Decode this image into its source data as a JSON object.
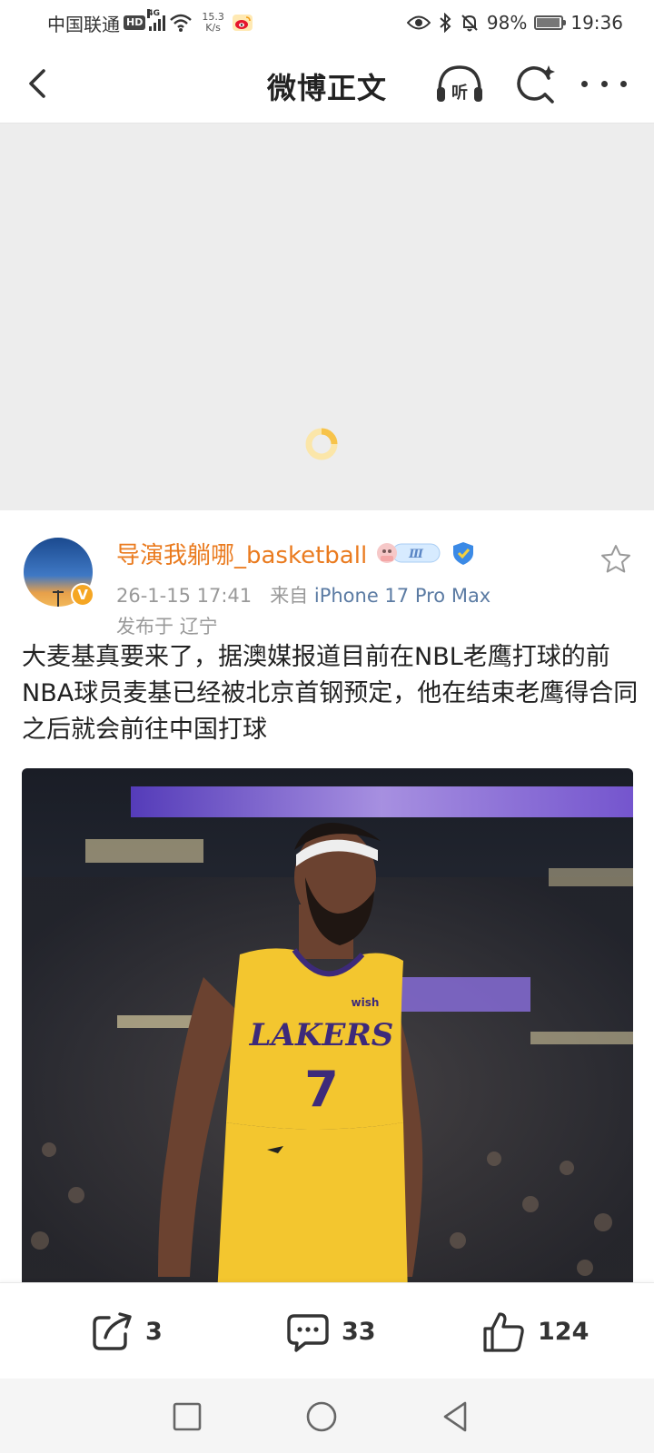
{
  "status_bar": {
    "carrier": "中国联通",
    "hd": "HD",
    "network": "4G",
    "speed_value": "15.3",
    "speed_unit": "K/s",
    "battery_text": "98%",
    "battery_level": 0.98,
    "time": "19:36"
  },
  "nav": {
    "title": "微博正文",
    "listen_label": "听"
  },
  "video": {
    "loading": true
  },
  "post": {
    "username": "导演我躺哪_basketball",
    "member_level": "Ⅲ",
    "timestamp": "26-1-15 17:41",
    "source_prefix": "来自",
    "device": "iPhone 17 Pro Max",
    "location_prefix": "发布于",
    "location": "辽宁",
    "verified_badge": "V",
    "text": "大麦基真要来了，据澳媒报道目前在NBL老鹰打球的前NBA球员麦基已经被北京首钢预定，他在结束老鹰得合同之后就会前往中国打球",
    "photo": {
      "jersey_team": "LAKERS",
      "jersey_number": "7",
      "jersey_sponsor": "wish"
    }
  },
  "actions": {
    "repost_count": "3",
    "comment_count": "33",
    "like_count": "124"
  },
  "colors": {
    "username": "#ea7b1f",
    "device_link": "#5b7ba3",
    "spinner": "#f7c34a",
    "lakers_gold": "#f3c62f",
    "lakers_purple": "#3d2a7a"
  }
}
